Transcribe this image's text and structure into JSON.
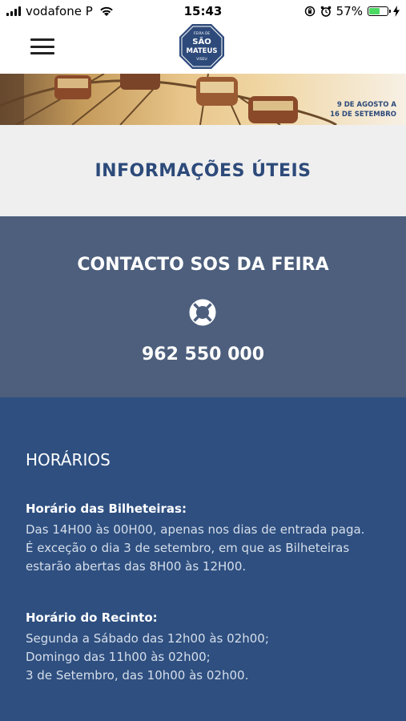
{
  "status_bar": {
    "carrier": "vodafone P",
    "time": "15:43",
    "battery": "57%",
    "battery_level": 0.57
  },
  "header": {
    "logo_small_top": "FEIRA DE",
    "logo_main_1": "SÃO",
    "logo_main_2": "MATEUS",
    "logo_small_bottom": "VISEU"
  },
  "hero": {
    "date_line_1": "9 DE AGOSTO A",
    "date_line_2": "16 DE SETEMBRO"
  },
  "page": {
    "title": "INFORMAÇÕES ÚTEIS"
  },
  "contact": {
    "title": "CONTACTO SOS DA FEIRA",
    "phone": "962 550 000"
  },
  "hours": {
    "title": "HORÁRIOS",
    "ticket": {
      "label": "Horário das Bilheteiras:",
      "lines": [
        "Das 14H00 às 00H00, apenas nos dias de entrada paga.",
        "É exceção o dia 3 de setembro, em que as Bilheteiras",
        "estarão abertas das 8H00 às 12H00."
      ]
    },
    "venue": {
      "label": "Horário do Recinto:",
      "lines": [
        "Segunda a Sábado das 12h00 às 02h00;",
        "Domingo das 11h00 às 02h00;",
        "3 de Setembro, das 10h00 às 02h00."
      ]
    }
  },
  "colors": {
    "brand_blue": "#2d4a7a",
    "contact_bg": "#4d5f7d",
    "hours_bg": "#2e4f80",
    "title_bg": "#efefef"
  }
}
